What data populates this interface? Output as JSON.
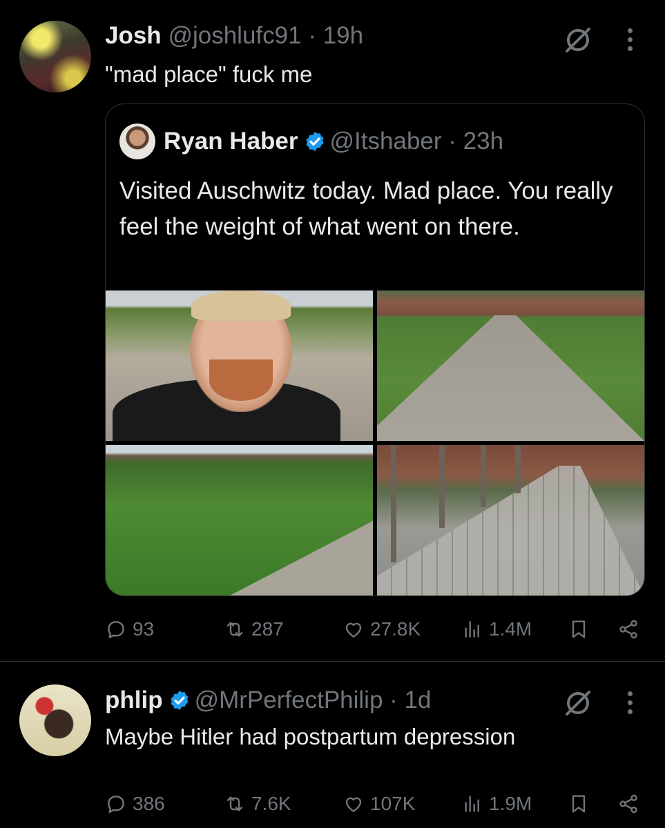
{
  "post1": {
    "author_name": "Josh",
    "handle": "@joshlufc91",
    "separator": "·",
    "time": "19h",
    "text": "\"mad place\" fuck me",
    "avatar_icon": "avatar-crowd-flares",
    "quote": {
      "author_name": "Ryan Haber",
      "verified": true,
      "handle": "@Itshaber",
      "separator": "·",
      "time": "23h",
      "text": "Visited Auschwitz today. Mad place. You really feel the weight of what went on there.",
      "images": [
        "selfie-photo",
        "gravel-road-photo",
        "grass-field-fence-photo",
        "cobblestone-path-fence-photo"
      ]
    },
    "stats": {
      "replies": "93",
      "reposts": "287",
      "likes": "27.8K",
      "views": "1.4M"
    }
  },
  "post2": {
    "author_name": "phlip",
    "verified": true,
    "handle": "@MrPerfectPhilip",
    "separator": "·",
    "time": "1d",
    "text": "Maybe Hitler had postpartum depression",
    "avatar_icon": "avatar-cartoon-bear",
    "stats": {
      "replies": "386",
      "reposts": "7.6K",
      "likes": "107K",
      "views": "1.9M"
    }
  },
  "colors": {
    "background": "#000000",
    "text": "#e7e9ea",
    "muted": "#71767b",
    "verified": "#1d9bf0",
    "border": "#2f3336"
  },
  "icons": [
    "grok-icon",
    "more-icon",
    "reply-icon",
    "repost-icon",
    "like-icon",
    "views-icon",
    "bookmark-icon",
    "share-icon",
    "verified-badge-icon"
  ]
}
